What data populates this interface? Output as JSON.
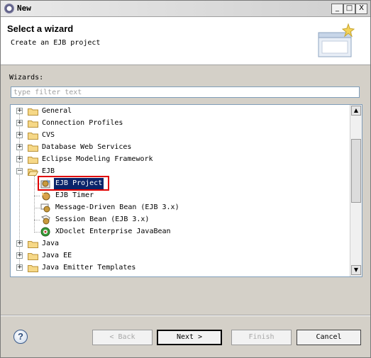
{
  "window": {
    "title": "New",
    "controls": {
      "minimize": "_",
      "maximize": "□",
      "close": "X"
    }
  },
  "banner": {
    "title": "Select a wizard",
    "description": "Create an EJB project"
  },
  "wizards_label": "Wizards:",
  "filter": {
    "placeholder": "type filter text",
    "value": ""
  },
  "tree": {
    "items": [
      {
        "label": "General",
        "expander": "+",
        "kind": "folder"
      },
      {
        "label": "Connection Profiles",
        "expander": "+",
        "kind": "folder"
      },
      {
        "label": "CVS",
        "expander": "+",
        "kind": "folder"
      },
      {
        "label": "Database Web Services",
        "expander": "+",
        "kind": "folder"
      },
      {
        "label": "Eclipse Modeling Framework",
        "expander": "+",
        "kind": "folder"
      },
      {
        "label": "EJB",
        "expander": "−",
        "kind": "folder"
      },
      {
        "label": "EJB Project",
        "kind": "ejb-project",
        "selected": true
      },
      {
        "label": "EJB Timer",
        "kind": "ejb-timer"
      },
      {
        "label": "Message-Driven Bean (EJB 3.x)",
        "kind": "mdb"
      },
      {
        "label": "Session Bean (EJB 3.x)",
        "kind": "session-bean"
      },
      {
        "label": "XDoclet Enterprise JavaBean",
        "kind": "xdoclet"
      },
      {
        "label": "Java",
        "expander": "+",
        "kind": "folder"
      },
      {
        "label": "Java EE",
        "expander": "+",
        "kind": "folder"
      },
      {
        "label": "Java Emitter Templates",
        "expander": "+",
        "kind": "folder"
      }
    ],
    "scroll": {
      "up": "▲",
      "down": "▼"
    }
  },
  "buttons": {
    "back": "< Back",
    "next": "Next >",
    "finish": "Finish",
    "cancel": "Cancel",
    "help": "?"
  },
  "colors": {
    "selection": "#0a246a",
    "highlight_box": "#e00000",
    "dialog_bg": "#d4d0c8"
  }
}
